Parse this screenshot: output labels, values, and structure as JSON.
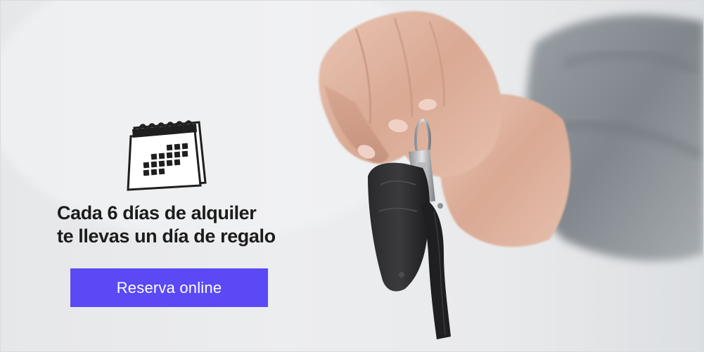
{
  "headline": {
    "line1": "Cada 6 días de alquiler",
    "line2": "te llevas un día de regalo"
  },
  "cta": {
    "label": "Reserva online"
  },
  "colors": {
    "button_bg": "#5a49f5",
    "button_text": "#ffffff",
    "headline_text": "#1c1c1c",
    "background": "#e9eaec"
  },
  "icons": {
    "calendar": "calendar-icon"
  }
}
